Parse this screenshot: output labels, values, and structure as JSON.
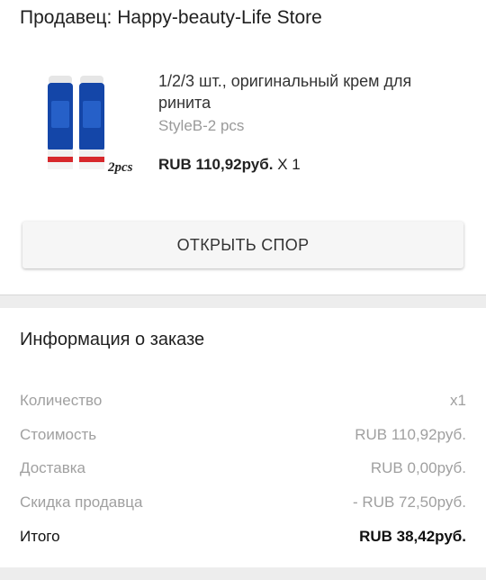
{
  "seller": {
    "label": "Продавец: Happy-beauty-Life Store"
  },
  "product": {
    "title": "1/2/3 шт., оригинальный крем для ринита",
    "variant": "StyleB-2 pcs",
    "price": "RUB 110,92руб.",
    "qty": "X 1",
    "image_caption": "2pcs"
  },
  "dispute_button": {
    "label": "ОТКРЫТЬ СПОР"
  },
  "order_info": {
    "title": "Информация о заказе",
    "rows": [
      {
        "label": "Количество",
        "value": "x1"
      },
      {
        "label": "Стоимость",
        "value": "RUB 110,92руб."
      },
      {
        "label": "Доставка",
        "value": "RUB 0,00руб."
      },
      {
        "label": "Скидка продавца",
        "value": "- RUB 72,50руб."
      },
      {
        "label": "Итого",
        "value": "RUB 38,42руб."
      }
    ]
  },
  "colors": {
    "tube_blue": "#1446a8",
    "tube_cap": "#e8e8e8",
    "tube_red": "#d7282c",
    "muted_text": "#a0a0a0"
  }
}
